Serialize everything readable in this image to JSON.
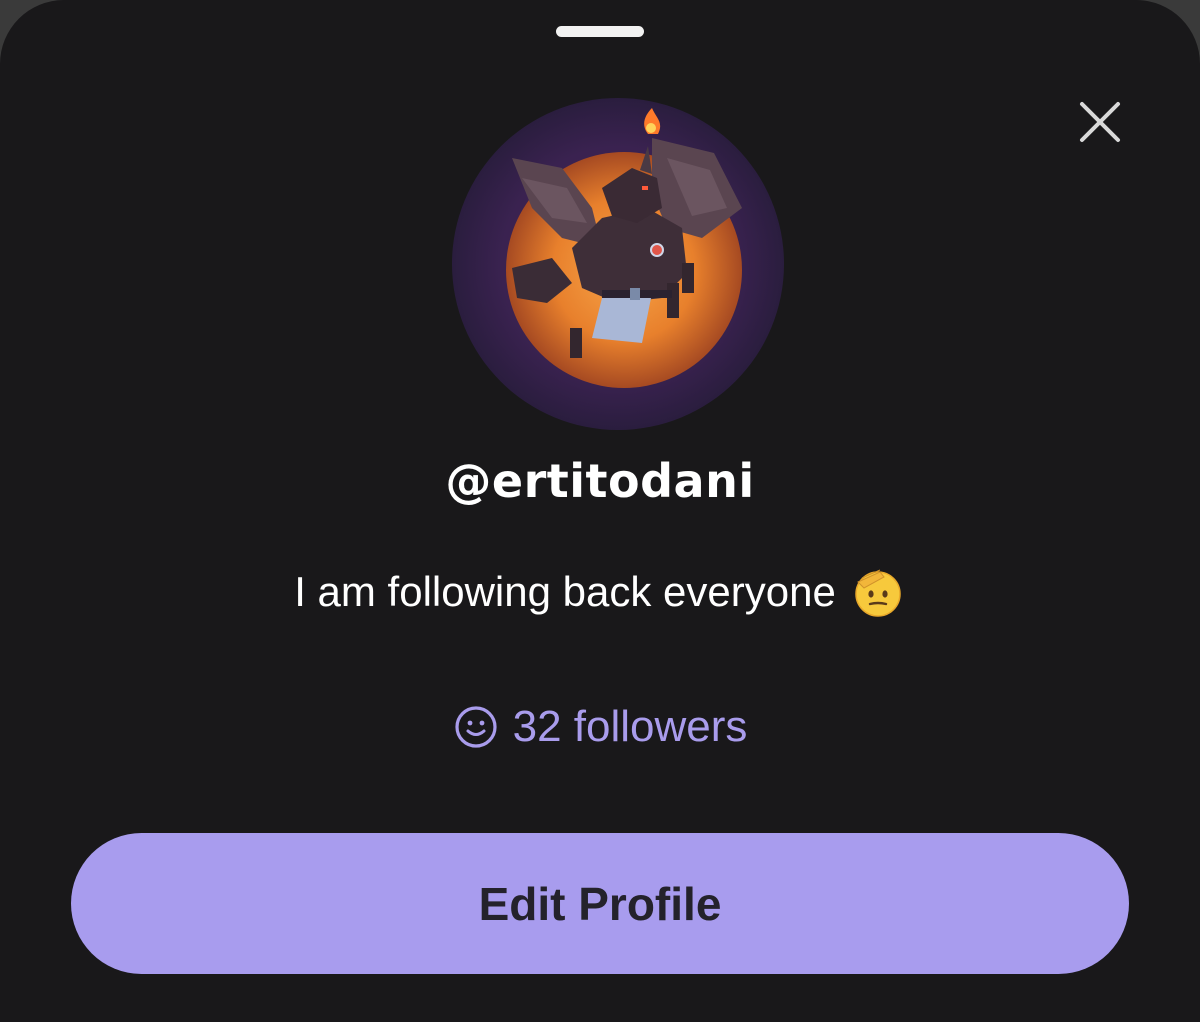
{
  "profile": {
    "username": "@ertitodani",
    "bio": "I am following back everyone",
    "bio_emoji": "saluting-face-emoji",
    "followers_label": "32 followers",
    "edit_button_label": "Edit Profile"
  },
  "icons": {
    "close": "close-icon",
    "followers": "smiley-icon"
  },
  "colors": {
    "background": "#19181a",
    "accent": "#a89cee",
    "followers_text": "#a99cec",
    "button_text": "#24222b",
    "text": "#ffffff"
  }
}
